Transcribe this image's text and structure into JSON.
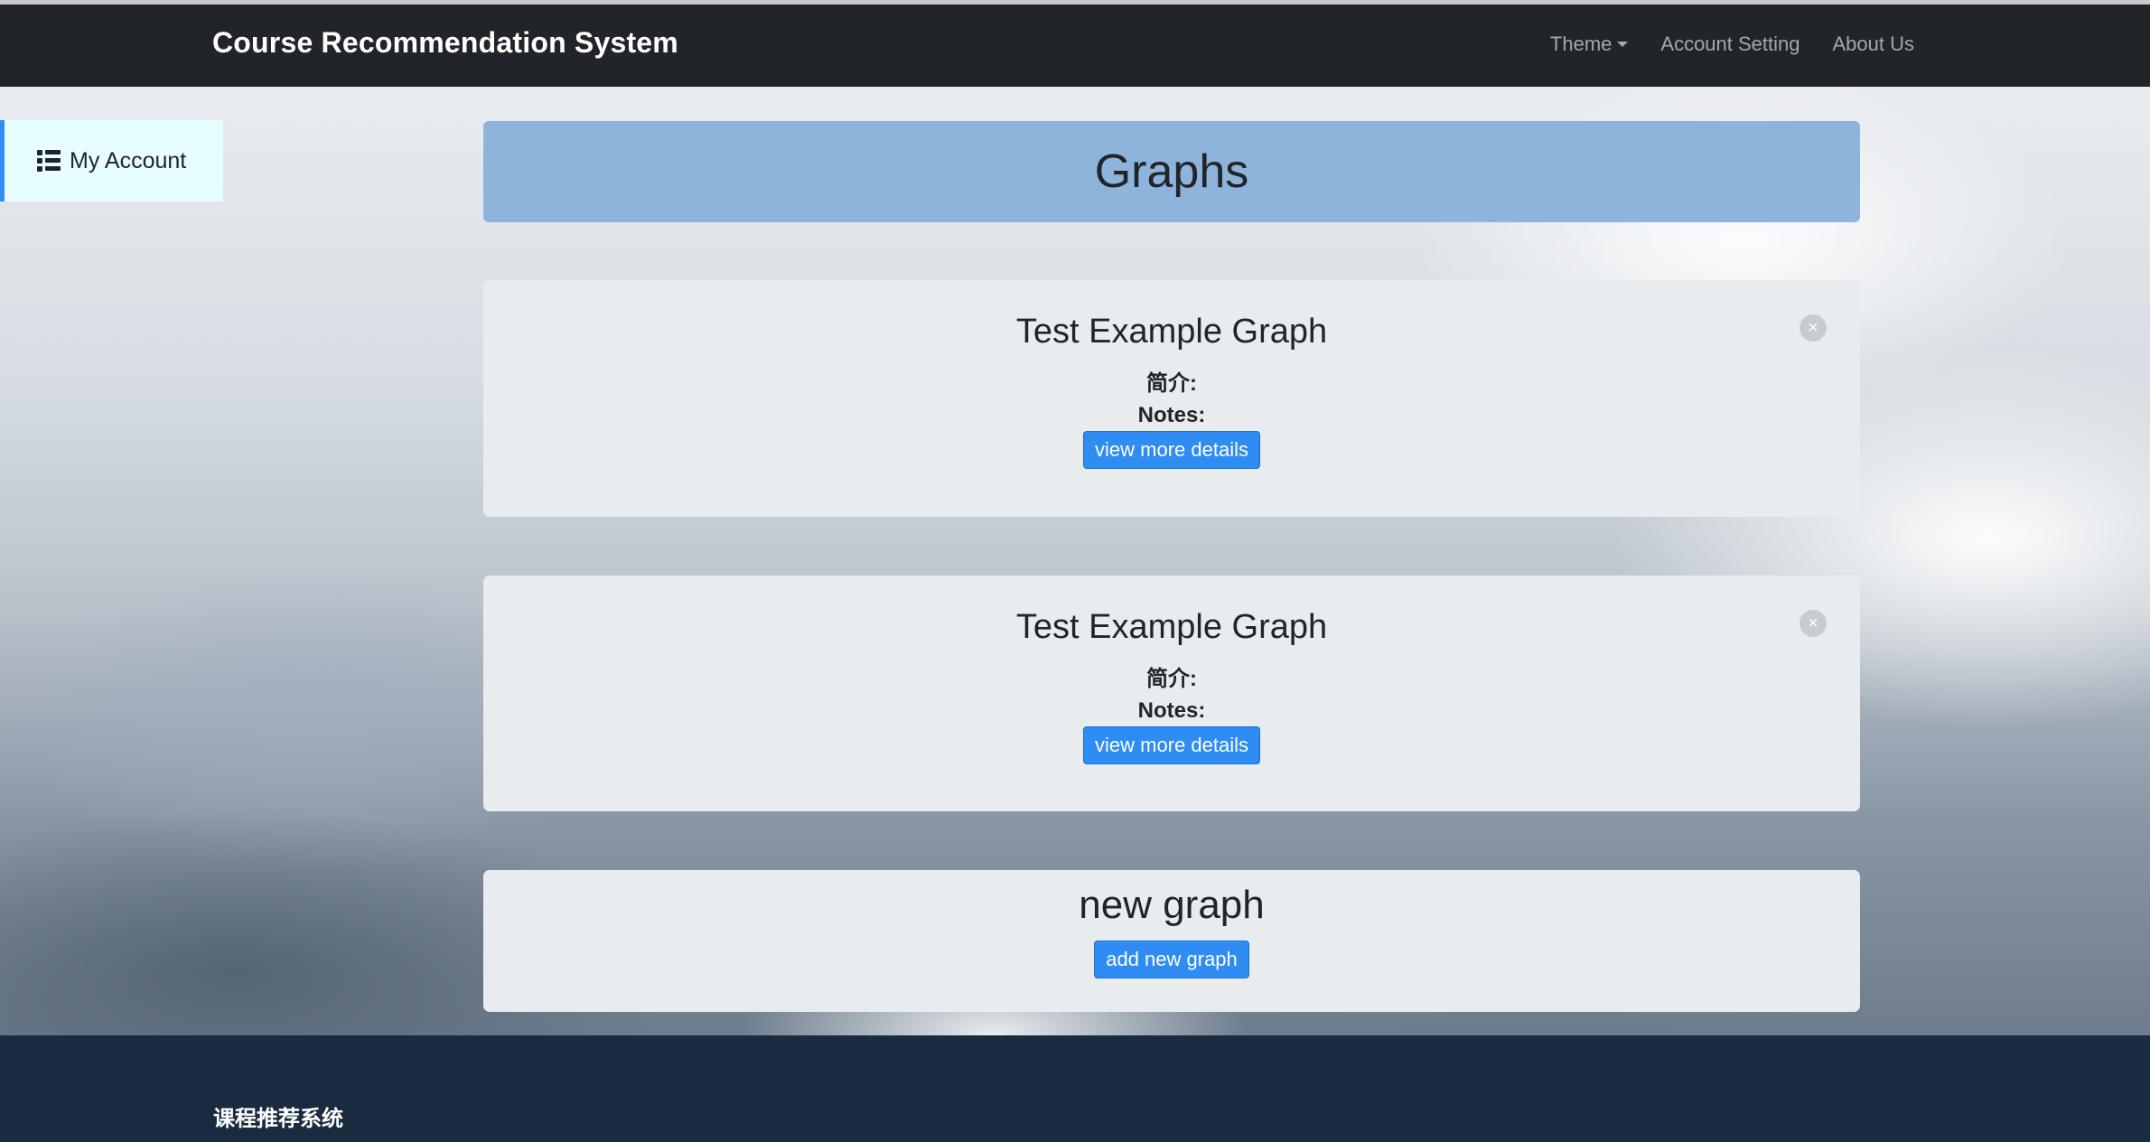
{
  "navbar": {
    "brand": "Course Recommendation System",
    "links": [
      {
        "label": "Theme"
      },
      {
        "label": "Account Setting"
      },
      {
        "label": "About Us"
      }
    ]
  },
  "sidebar": {
    "account_label": "My Account",
    "icon": "list-icon"
  },
  "page": {
    "title": "Graphs"
  },
  "graphs": [
    {
      "title": "Test Example Graph",
      "intro_label": "简介:",
      "notes_label": "Notes:",
      "button_label": "view more details",
      "close_symbol": "×"
    },
    {
      "title": "Test Example Graph",
      "intro_label": "简介:",
      "notes_label": "Notes:",
      "button_label": "view more details",
      "close_symbol": "×"
    }
  ],
  "new_graph": {
    "title": "new graph",
    "button_label": "add new graph"
  },
  "footer": {
    "text": "课程推荐系统"
  },
  "colors": {
    "navbar_bg": "#212529",
    "accent": "#2f8cf3",
    "header_bg": "#8fb4dc",
    "card_bg": "#e9ecef",
    "sidebar_bg": "#e6feff",
    "footer_bg": "#1a2b40"
  }
}
